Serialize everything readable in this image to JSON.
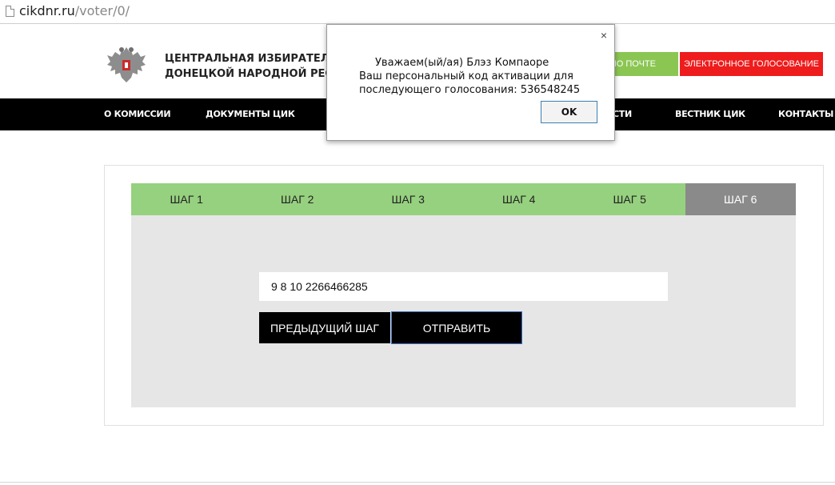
{
  "address_bar": {
    "host": "cikdnr.ru",
    "path": "/voter/0/"
  },
  "header": {
    "org_line1": "ЦЕНТРАЛЬНАЯ ИЗБИРАТЕЛЬНА",
    "org_line2": "ДОНЕЦКОЙ НАРОДНОЙ РЕСПУ",
    "mail_button": "ПО ПОЧТЕ",
    "evote_button": "ЭЛЕКТРОННОЕ ГОЛОСОВАНИЕ"
  },
  "nav": {
    "items": [
      {
        "label": "О КОМИССИИ"
      },
      {
        "label": "ДОКУМЕНТЫ ЦИК"
      },
      {
        "label": ""
      },
      {
        "label": "СТИ"
      },
      {
        "label": "ВЕСТНИК ЦИК"
      },
      {
        "label": "КОНТАКТЫ"
      }
    ]
  },
  "steps": [
    {
      "label": "ШАГ 1"
    },
    {
      "label": "ШАГ 2"
    },
    {
      "label": "ШАГ 3"
    },
    {
      "label": "ШАГ 4"
    },
    {
      "label": "ШАГ 5"
    },
    {
      "label": "ШАГ 6",
      "active": true
    }
  ],
  "form": {
    "code_value": "9 8 10 2266466285",
    "prev_button": "ПРЕДЫДУЩИЙ ШАГ",
    "send_button": "ОТПРАВИТЬ"
  },
  "dialog": {
    "close_icon": "×",
    "line1": "Уважаем(ый/ая) Блэз Компаоре",
    "line2": "Ваш персональный код активации для",
    "line3": "последующего голосования: 536548245",
    "ok_button": "OK"
  },
  "colors": {
    "step_done": "#96d17f",
    "step_active": "#8a8a8a",
    "evote": "#ee1c1c",
    "mail": "#8bc653",
    "nav_bg": "#000000"
  }
}
